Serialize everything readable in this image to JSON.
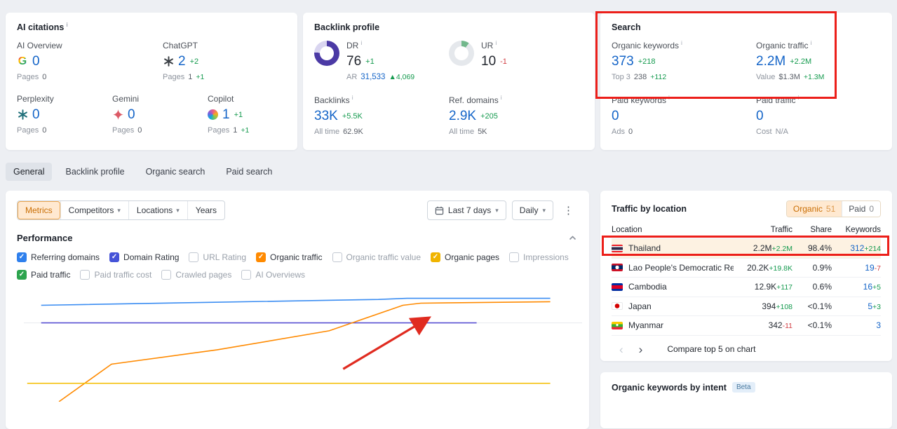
{
  "colors": {
    "accent_blue": "#1565c8",
    "positive_green": "#149a4e",
    "negative_red": "#d23f44",
    "orange": "#ff8a00",
    "annotation_red": "#ec1f1a"
  },
  "icons": {
    "prev": "‹",
    "next": "›",
    "kebab": "⋮",
    "chevron_down": "▾"
  },
  "ai_citations": {
    "title": "AI citations",
    "items": [
      {
        "name": "AI Overview",
        "icon": "google",
        "value": "0",
        "delta": "",
        "pages_label": "Pages",
        "pages": "0",
        "pages_delta": ""
      },
      {
        "name": "ChatGPT",
        "icon": "chatgpt",
        "value": "2",
        "delta": "+2",
        "pages_label": "Pages",
        "pages": "1",
        "pages_delta": "+1"
      },
      {
        "name": "Perplexity",
        "icon": "perplexity",
        "value": "0",
        "delta": "",
        "pages_label": "Pages",
        "pages": "0",
        "pages_delta": ""
      },
      {
        "name": "Gemini",
        "icon": "gemini",
        "value": "0",
        "delta": "",
        "pages_label": "Pages",
        "pages": "0",
        "pages_delta": ""
      },
      {
        "name": "Copilot",
        "icon": "copilot",
        "value": "1",
        "delta": "+1",
        "pages_label": "Pages",
        "pages": "1",
        "pages_delta": "+1"
      }
    ]
  },
  "backlink_profile": {
    "title": "Backlink profile",
    "dr": {
      "label": "DR",
      "value": "76",
      "delta": "+1",
      "percent": 76,
      "ar_label": "AR",
      "ar_value": "31,533",
      "ar_delta": "▲4,069"
    },
    "ur": {
      "label": "UR",
      "value": "10",
      "delta": "-1",
      "percent": 10
    },
    "backlinks": {
      "label": "Backlinks",
      "value": "33K",
      "delta": "+5.5K",
      "alltime_label": "All time",
      "alltime_value": "62.9K"
    },
    "ref_domains": {
      "label": "Ref. domains",
      "value": "2.9K",
      "delta": "+205",
      "alltime_label": "All time",
      "alltime_value": "5K"
    }
  },
  "search": {
    "title": "Search",
    "organic_keywords": {
      "label": "Organic keywords",
      "value": "373",
      "delta": "+218",
      "sub_label": "Top 3",
      "sub_value": "238",
      "sub_delta": "+112"
    },
    "organic_traffic": {
      "label": "Organic traffic",
      "value": "2.2M",
      "delta": "+2.2M",
      "sub_label": "Value",
      "sub_value": "$1.3M",
      "sub_delta": "+1.3M"
    },
    "paid_keywords": {
      "label": "Paid keywords",
      "value": "0",
      "delta": "",
      "sub_label": "Ads",
      "sub_value": "0",
      "sub_delta": ""
    },
    "paid_traffic": {
      "label": "Paid traffic",
      "value": "0",
      "delta": "",
      "sub_label": "Cost",
      "sub_value": "N/A",
      "sub_delta": ""
    }
  },
  "tabs": [
    {
      "label": "General",
      "active": true
    },
    {
      "label": "Backlink profile",
      "active": false
    },
    {
      "label": "Organic search",
      "active": false
    },
    {
      "label": "Paid search",
      "active": false
    }
  ],
  "toolbar": {
    "metrics": "Metrics",
    "competitors": "Competitors",
    "locations": "Locations",
    "years": "Years",
    "date_range": "Last 7 days",
    "granularity": "Daily"
  },
  "performance": {
    "title": "Performance",
    "metrics": [
      {
        "label": "Referring domains",
        "checked": true,
        "color": "#2f80ed"
      },
      {
        "label": "Domain Rating",
        "checked": true,
        "color": "#4553d8"
      },
      {
        "label": "URL Rating",
        "checked": false
      },
      {
        "label": "Organic traffic",
        "checked": true,
        "color": "#ff8a00"
      },
      {
        "label": "Organic traffic value",
        "checked": false
      },
      {
        "label": "Organic pages",
        "checked": true,
        "color": "#f0b400"
      },
      {
        "label": "Impressions",
        "checked": false
      },
      {
        "label": "Paid traffic",
        "checked": true,
        "color": "#2da44e"
      },
      {
        "label": "Paid traffic cost",
        "checked": false
      },
      {
        "label": "Crawled pages",
        "checked": false
      },
      {
        "label": "AI Overviews",
        "checked": false
      }
    ]
  },
  "chart_data": {
    "type": "line",
    "x_range_label": "Last 7 days",
    "granularity": "Daily",
    "legend": [
      "Referring domains",
      "Domain Rating",
      "Organic traffic",
      "Organic pages"
    ],
    "series": [
      {
        "name": "Referring domains",
        "color": "#3b8df2",
        "points_pct": [
          [
            3.1,
            78.6
          ],
          [
            33.3,
            81.0
          ],
          [
            63.5,
            83.3
          ],
          [
            68.6,
            84.2
          ],
          [
            94.3,
            84.2
          ]
        ]
      },
      {
        "name": "Domain Rating",
        "color": "#5a51d3",
        "points_pct": [
          [
            3.1,
            64.2
          ],
          [
            81.1,
            64.2
          ]
        ]
      },
      {
        "name": "Organic traffic",
        "color": "#ff8a00",
        "points_pct": [
          [
            6.3,
            0
          ],
          [
            15.7,
            30.6
          ],
          [
            34.6,
            42.2
          ],
          [
            54.7,
            57.8
          ],
          [
            67.9,
            78.6
          ],
          [
            71.1,
            80.3
          ],
          [
            94.3,
            81.5
          ]
        ]
      },
      {
        "name": "Organic pages",
        "color": "#f5c211",
        "points_pct": [
          [
            0.6,
            15.0
          ],
          [
            94.3,
            15.0
          ]
        ]
      }
    ],
    "gridlines_pct": [
      64.2
    ],
    "annotation_arrow": {
      "from_pct": [
        57.2,
        26.6
      ],
      "to_pct": [
        72.3,
        67.6
      ],
      "color": "#e02b20"
    }
  },
  "traffic_by_location": {
    "title": "Traffic by location",
    "organic_label": "Organic",
    "organic_count": "51",
    "paid_label": "Paid",
    "paid_count": "0",
    "columns": [
      "Location",
      "Traffic",
      "Share",
      "Keywords"
    ],
    "rows": [
      {
        "location": "Thailand",
        "flag": "thailand",
        "traffic": "2.2M",
        "traffic_delta": "+2.2M",
        "share": "98.4%",
        "keywords": "312",
        "keywords_delta": "+214",
        "highlighted": true
      },
      {
        "location": "Lao People's Democratic Reput",
        "flag": "laos",
        "traffic": "20.2K",
        "traffic_delta": "+19.8K",
        "share": "0.9%",
        "keywords": "19",
        "keywords_delta": "-7",
        "highlighted": false
      },
      {
        "location": "Cambodia",
        "flag": "cambodia",
        "traffic": "12.9K",
        "traffic_delta": "+117",
        "share": "0.6%",
        "keywords": "16",
        "keywords_delta": "+5",
        "highlighted": false
      },
      {
        "location": "Japan",
        "flag": "japan",
        "traffic": "394",
        "traffic_delta": "+108",
        "share": "<0.1%",
        "keywords": "5",
        "keywords_delta": "+3",
        "highlighted": false
      },
      {
        "location": "Myanmar",
        "flag": "myanmar",
        "traffic": "342",
        "traffic_delta": "-11",
        "share": "<0.1%",
        "keywords": "3",
        "keywords_delta": "",
        "highlighted": false
      }
    ],
    "footer": "Compare top 5 on chart"
  },
  "intent": {
    "title": "Organic keywords by intent",
    "badge": "Beta"
  }
}
